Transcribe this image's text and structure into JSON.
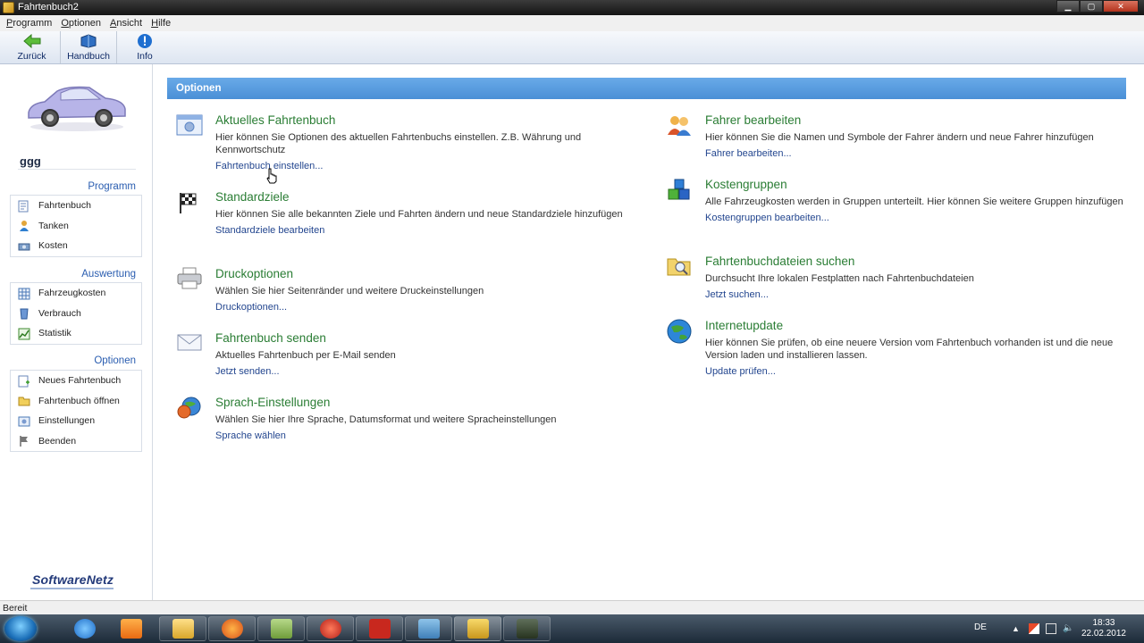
{
  "window": {
    "title": "Fahrtenbuch2"
  },
  "menu": [
    "Programm",
    "Optionen",
    "Ansicht",
    "Hilfe"
  ],
  "toolbar": {
    "back": "Zurück",
    "manual": "Handbuch",
    "info": "Info"
  },
  "sidebar": {
    "username": "ggg",
    "groups": [
      {
        "title": "Programm",
        "items": [
          "Fahrtenbuch",
          "Tanken",
          "Kosten"
        ]
      },
      {
        "title": "Auswertung",
        "items": [
          "Fahrzeugkosten",
          "Verbrauch",
          "Statistik"
        ]
      },
      {
        "title": "Optionen",
        "items": [
          "Neues Fahrtenbuch",
          "Fahrtenbuch öffnen",
          "Einstellungen",
          "Beenden"
        ]
      }
    ],
    "brand": "SoftwareNetz"
  },
  "main": {
    "banner": "Optionen",
    "left": [
      {
        "title": "Aktuelles Fahrtenbuch",
        "desc": "Hier können Sie Optionen des aktuellen Fahrtenbuchs einstellen. Z.B. Währung und Kennwortschutz",
        "link": "Fahrtenbuch einstellen..."
      },
      {
        "title": "Standardziele",
        "desc": "Hier können Sie alle bekannten Ziele und Fahrten ändern und neue Standardziele hinzufügen",
        "link": "Standardziele bearbeiten"
      },
      {
        "title": "Druckoptionen",
        "desc": "Wählen Sie hier Seitenränder und weitere Druckeinstellungen",
        "link": "Druckoptionen..."
      },
      {
        "title": "Fahrtenbuch senden",
        "desc": "Aktuelles Fahrtenbuch per E-Mail senden",
        "link": "Jetzt senden..."
      },
      {
        "title": "Sprach-Einstellungen",
        "desc": "Wählen Sie hier Ihre Sprache, Datumsformat und weitere Spracheinstellungen",
        "link": "Sprache wählen"
      }
    ],
    "right": [
      {
        "title": "Fahrer bearbeiten",
        "desc": "Hier können Sie die Namen und Symbole der Fahrer ändern und neue Fahrer hinzufügen",
        "link": "Fahrer bearbeiten..."
      },
      {
        "title": "Kostengruppen",
        "desc": "Alle Fahrzeugkosten werden in Gruppen unterteilt. Hier können Sie weitere Gruppen hinzufügen",
        "link": "Kostengruppen bearbeiten..."
      },
      {
        "title": "Fahrtenbuchdateien suchen",
        "desc": "Durchsucht Ihre lokalen Festplatten nach Fahrtenbuchdateien",
        "link": "Jetzt suchen..."
      },
      {
        "title": "Internetupdate",
        "desc": "Hier können Sie prüfen, ob eine neuere Version vom Fahrtenbuch vorhanden ist und die neue Version laden und installieren lassen.",
        "link": "Update prüfen..."
      }
    ]
  },
  "status": {
    "text": "Bereit"
  },
  "taskbar": {
    "lang": "DE",
    "time": "18:33",
    "date": "22.02.2012"
  },
  "colors": {
    "banner": "#4a8fd6",
    "option_title": "#2a7d34",
    "link": "#23468f",
    "group_title": "#2a5db0"
  }
}
